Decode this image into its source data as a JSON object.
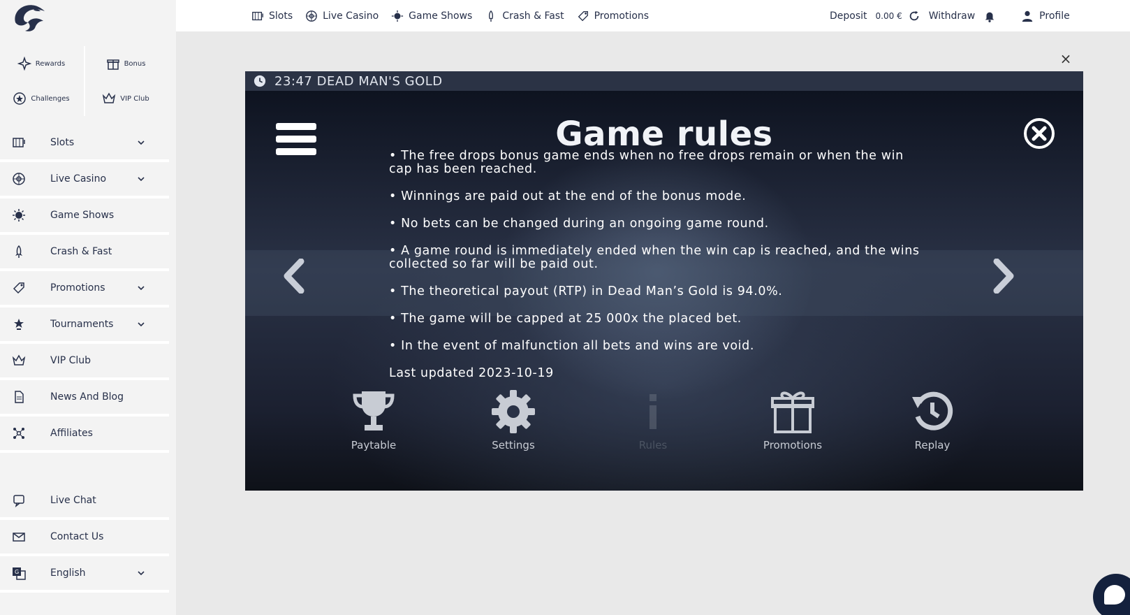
{
  "quick_links": [
    {
      "label": "Rewards",
      "icon": "sparkle-star-icon"
    },
    {
      "label": "Bonus",
      "icon": "gift-icon"
    },
    {
      "label": "Challenges",
      "icon": "star-badge-icon"
    },
    {
      "label": "VIP Club",
      "icon": "crown-icon"
    }
  ],
  "sidebar": {
    "items": [
      {
        "label": "Slots",
        "icon": "slot-machine-icon",
        "has_chevron": true
      },
      {
        "label": "Live Casino",
        "icon": "roulette-icon",
        "has_chevron": true
      },
      {
        "label": "Game Shows",
        "icon": "game-show-icon",
        "has_chevron": false
      },
      {
        "label": "Crash & Fast",
        "icon": "rocket-icon",
        "has_chevron": false
      },
      {
        "label": "Promotions",
        "icon": "tag-icon",
        "has_chevron": true
      },
      {
        "label": "Tournaments",
        "icon": "trophy-icon",
        "has_chevron": true
      },
      {
        "label": "VIP Club",
        "icon": "crown-icon",
        "has_chevron": false
      },
      {
        "label": "News And Blog",
        "icon": "document-icon",
        "has_chevron": false
      },
      {
        "label": "Affiliates",
        "icon": "network-icon",
        "has_chevron": false
      }
    ],
    "support": [
      {
        "label": "Live Chat",
        "icon": "chat-icon"
      },
      {
        "label": "Contact Us",
        "icon": "mail-icon"
      },
      {
        "label": "English",
        "icon": "translate-icon",
        "has_chevron": true
      }
    ]
  },
  "topnav": {
    "items": [
      {
        "label": "Slots",
        "icon": "slot-machine-icon"
      },
      {
        "label": "Live Casino",
        "icon": "roulette-icon"
      },
      {
        "label": "Game Shows",
        "icon": "game-show-icon"
      },
      {
        "label": "Crash & Fast",
        "icon": "rocket-icon"
      },
      {
        "label": "Promotions",
        "icon": "tag-icon"
      }
    ],
    "deposit_label": "Deposit",
    "balance": "0.00 €",
    "withdraw_label": "Withdraw",
    "profile_label": "Profile"
  },
  "game": {
    "header": "23:47 DEAD MAN'S GOLD",
    "rules_title": "Game rules",
    "rules": [
      "• The free drops bonus game ends when no free drops remain or when the win cap has been reached.",
      "• Winnings are paid out at the end of the bonus mode.",
      "• No bets can be changed during an ongoing game round.",
      "• A game round is immediately ended when the win cap is reached, and the wins collected so far will be paid out.",
      "• The theoretical payout (RTP) in Dead Man’s Gold is 94.0%.",
      "• The game will be capped at 25 000x the placed bet.",
      "• In the event of malfunction all bets and wins are void."
    ],
    "last_updated": "Last updated 2023-10-19",
    "bottom_nav": [
      {
        "label": "Paytable",
        "icon": "trophy-icon"
      },
      {
        "label": "Settings",
        "icon": "gear-icon"
      },
      {
        "label": "Rules",
        "icon": "info-icon",
        "active": true
      },
      {
        "label": "Promotions",
        "icon": "gift-icon"
      },
      {
        "label": "Replay",
        "icon": "replay-icon"
      }
    ]
  },
  "colors": {
    "brand": "#27304a",
    "chat": "#14213d"
  }
}
